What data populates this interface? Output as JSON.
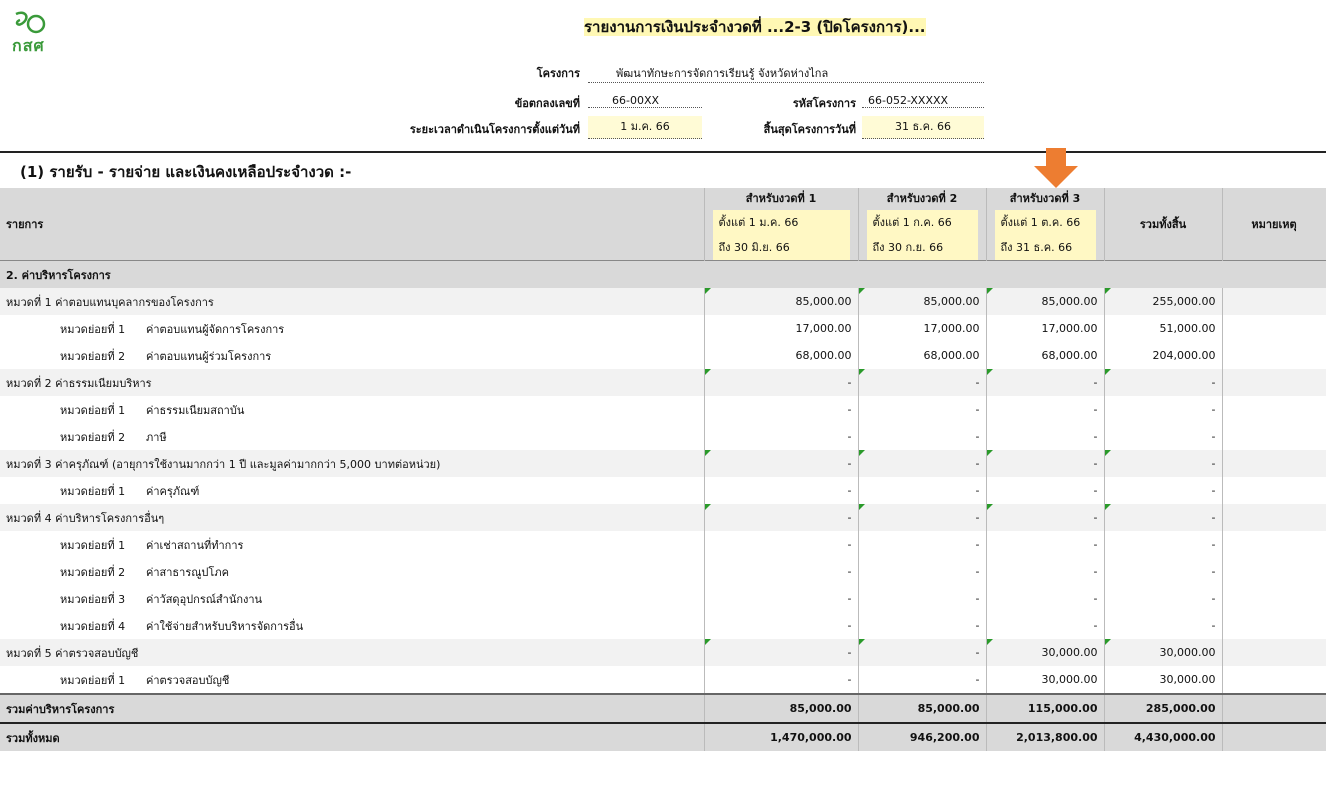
{
  "logo": {
    "text": "กสศ"
  },
  "report": {
    "title": "รายงานการเงินประจำงวดที่ ...2-3 (ปิดโครงการ)..."
  },
  "project": {
    "name_label": "โครงการ",
    "name_value": "พัฒนาทักษะการจัดการเรียนรู้ จังหวัดห่างไกล",
    "agreement_label": "ข้อตกลงเลขที่",
    "agreement_value": "66-00XX",
    "code_label": "รหัสโครงการ",
    "code_value": "66-052-XXXXX",
    "start_label": "ระยะเวลาดำเนินโครงการตั้งแต่วันที่",
    "start_value": "1 ม.ค. 66",
    "end_label": "สิ้นสุดโครงการวันที่",
    "end_value": "31 ธ.ค. 66"
  },
  "section": {
    "title": "(1) รายรับ - รายจ่าย และเงินคงเหลือประจำงวด :-"
  },
  "colors": {
    "arrow": "#ed7d31",
    "highlight": "#fff8c4",
    "header_gray": "#d9d9d9"
  },
  "table": {
    "item_header": "รายการ",
    "periods": [
      {
        "title": "สำหรับงวดที่ 1",
        "from": "ตั้งแต่ 1 ม.ค. 66",
        "to": "ถึง 30 มิ.ย. 66"
      },
      {
        "title": "สำหรับงวดที่ 2",
        "from": "ตั้งแต่ 1 ก.ค. 66",
        "to": "ถึง 30 ก.ย. 66"
      },
      {
        "title": "สำหรับงวดที่ 3",
        "from": "ตั้งแต่ 1 ต.ค. 66",
        "to": "ถึง 31 ธ.ค. 66"
      }
    ],
    "total_header": "รวมทั้งสิ้น",
    "remark_header": "หมายเหตุ",
    "section_label": "2. ค่าบริหารโครงการ",
    "rows": [
      {
        "code": "",
        "label": "หมวดที่ 1 ค่าตอบแทนบุคลากรของโครงการ",
        "v1": "85,000.00",
        "v2": "85,000.00",
        "v3": "85,000.00",
        "total": "255,000.00"
      },
      {
        "code": "หมวดย่อยที่ 1",
        "label": "ค่าตอบแทนผู้จัดการโครงการ",
        "v1": "17,000.00",
        "v2": "17,000.00",
        "v3": "17,000.00",
        "total": "51,000.00"
      },
      {
        "code": "หมวดย่อยที่ 2",
        "label": "ค่าตอบแทนผู้ร่วมโครงการ",
        "v1": "68,000.00",
        "v2": "68,000.00",
        "v3": "68,000.00",
        "total": "204,000.00"
      },
      {
        "code": "",
        "label": "หมวดที่ 2 ค่าธรรมเนียมบริหาร",
        "v1": "-",
        "v2": "-",
        "v3": "-",
        "total": "-"
      },
      {
        "code": "หมวดย่อยที่ 1",
        "label": "ค่าธรรมเนียมสถาบัน",
        "v1": "-",
        "v2": "-",
        "v3": "-",
        "total": "-"
      },
      {
        "code": "หมวดย่อยที่ 2",
        "label": "ภาษี",
        "v1": "-",
        "v2": "-",
        "v3": "-",
        "total": "-"
      },
      {
        "code": "",
        "label": "หมวดที่ 3 ค่าครุภัณฑ์ (อายุการใช้งานมากกว่า 1 ปี และมูลค่ามากกว่า 5,000 บาทต่อหน่วย)",
        "v1": "-",
        "v2": "-",
        "v3": "-",
        "total": "-"
      },
      {
        "code": "หมวดย่อยที่ 1",
        "label": "ค่าครุภัณฑ์",
        "v1": "-",
        "v2": "-",
        "v3": "-",
        "total": "-"
      },
      {
        "code": "",
        "label": "หมวดที่ 4 ค่าบริหารโครงการอื่นๆ",
        "v1": "-",
        "v2": "-",
        "v3": "-",
        "total": "-"
      },
      {
        "code": "หมวดย่อยที่ 1",
        "label": "ค่าเช่าสถานที่ทำการ",
        "v1": "-",
        "v2": "-",
        "v3": "-",
        "total": "-"
      },
      {
        "code": "หมวดย่อยที่ 2",
        "label": "ค่าสาธารณูปโภค",
        "v1": "-",
        "v2": "-",
        "v3": "-",
        "total": "-"
      },
      {
        "code": "หมวดย่อยที่ 3",
        "label": "ค่าวัสดุอุปกรณ์สำนักงาน",
        "v1": "-",
        "v2": "-",
        "v3": "-",
        "total": "-"
      },
      {
        "code": "หมวดย่อยที่ 4",
        "label": "ค่าใช้จ่ายสำหรับบริหารจัดการอื่น",
        "v1": "-",
        "v2": "-",
        "v3": "-",
        "total": "-"
      },
      {
        "code": "",
        "label": "หมวดที่ 5 ค่าตรวจสอบบัญชี",
        "v1": "-",
        "v2": "-",
        "v3": "30,000.00",
        "total": "30,000.00"
      },
      {
        "code": "หมวดย่อยที่ 1",
        "label": "ค่าตรวจสอบบัญชี",
        "v1": "-",
        "v2": "-",
        "v3": "30,000.00",
        "total": "30,000.00"
      }
    ],
    "subtotal": {
      "label": "รวมค่าบริหารโครงการ",
      "v1": "85,000.00",
      "v2": "85,000.00",
      "v3": "115,000.00",
      "total": "285,000.00"
    },
    "grand": {
      "label": "รวมทั้งหมด",
      "v1": "1,470,000.00",
      "v2": "946,200.00",
      "v3": "2,013,800.00",
      "total": "4,430,000.00"
    }
  }
}
